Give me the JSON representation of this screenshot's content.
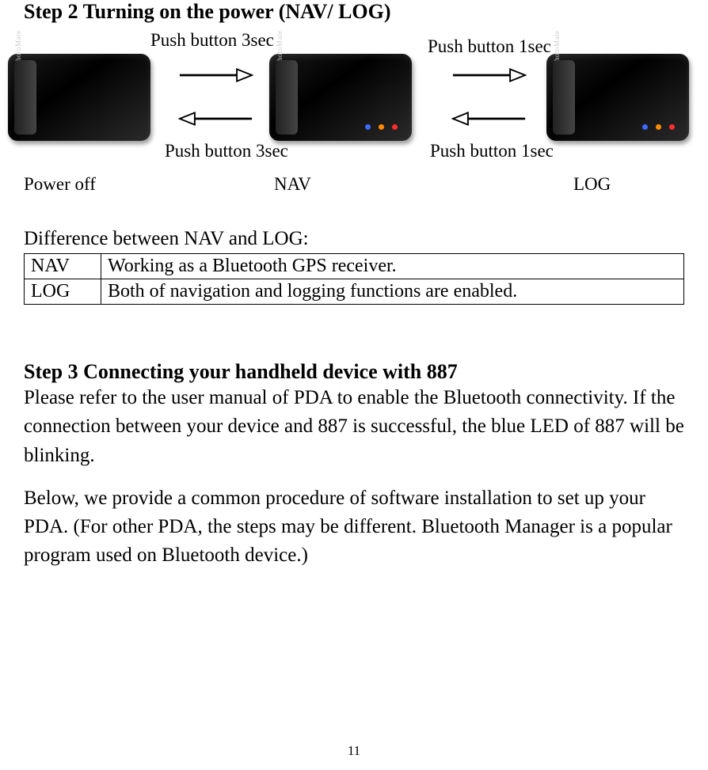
{
  "step2": {
    "title": "Step 2 Turning on the power (NAV/ LOG)",
    "arrow1_top": "Push button    3sec",
    "arrow1_bottom": "Push button 3sec",
    "arrow2_top": "Push button 1sec",
    "arrow2_bottom": "Push button 1sec",
    "state_poweroff": "Power off",
    "state_nav": "NAV",
    "state_log": "LOG"
  },
  "diff": {
    "title": "Difference between NAV and LOG:",
    "rows": [
      {
        "key": "NAV",
        "desc": "Working as a Bluetooth GPS receiver."
      },
      {
        "key": "LOG",
        "desc": "Both of navigation and logging functions are enabled."
      }
    ]
  },
  "step3": {
    "title": "Step 3 Connecting your handheld device with 887",
    "para1": "Please refer to the user manual of PDA to enable the Bluetooth connectivity. If the connection between your device and 887 is successful, the blue LED of 887 will be blinking.",
    "para2": "Below, we provide a common procedure of software installation to set up your PDA. (For other PDA, the steps may be different. Bluetooth Manager is a popular program used on Bluetooth device.)"
  },
  "page_number": "11"
}
